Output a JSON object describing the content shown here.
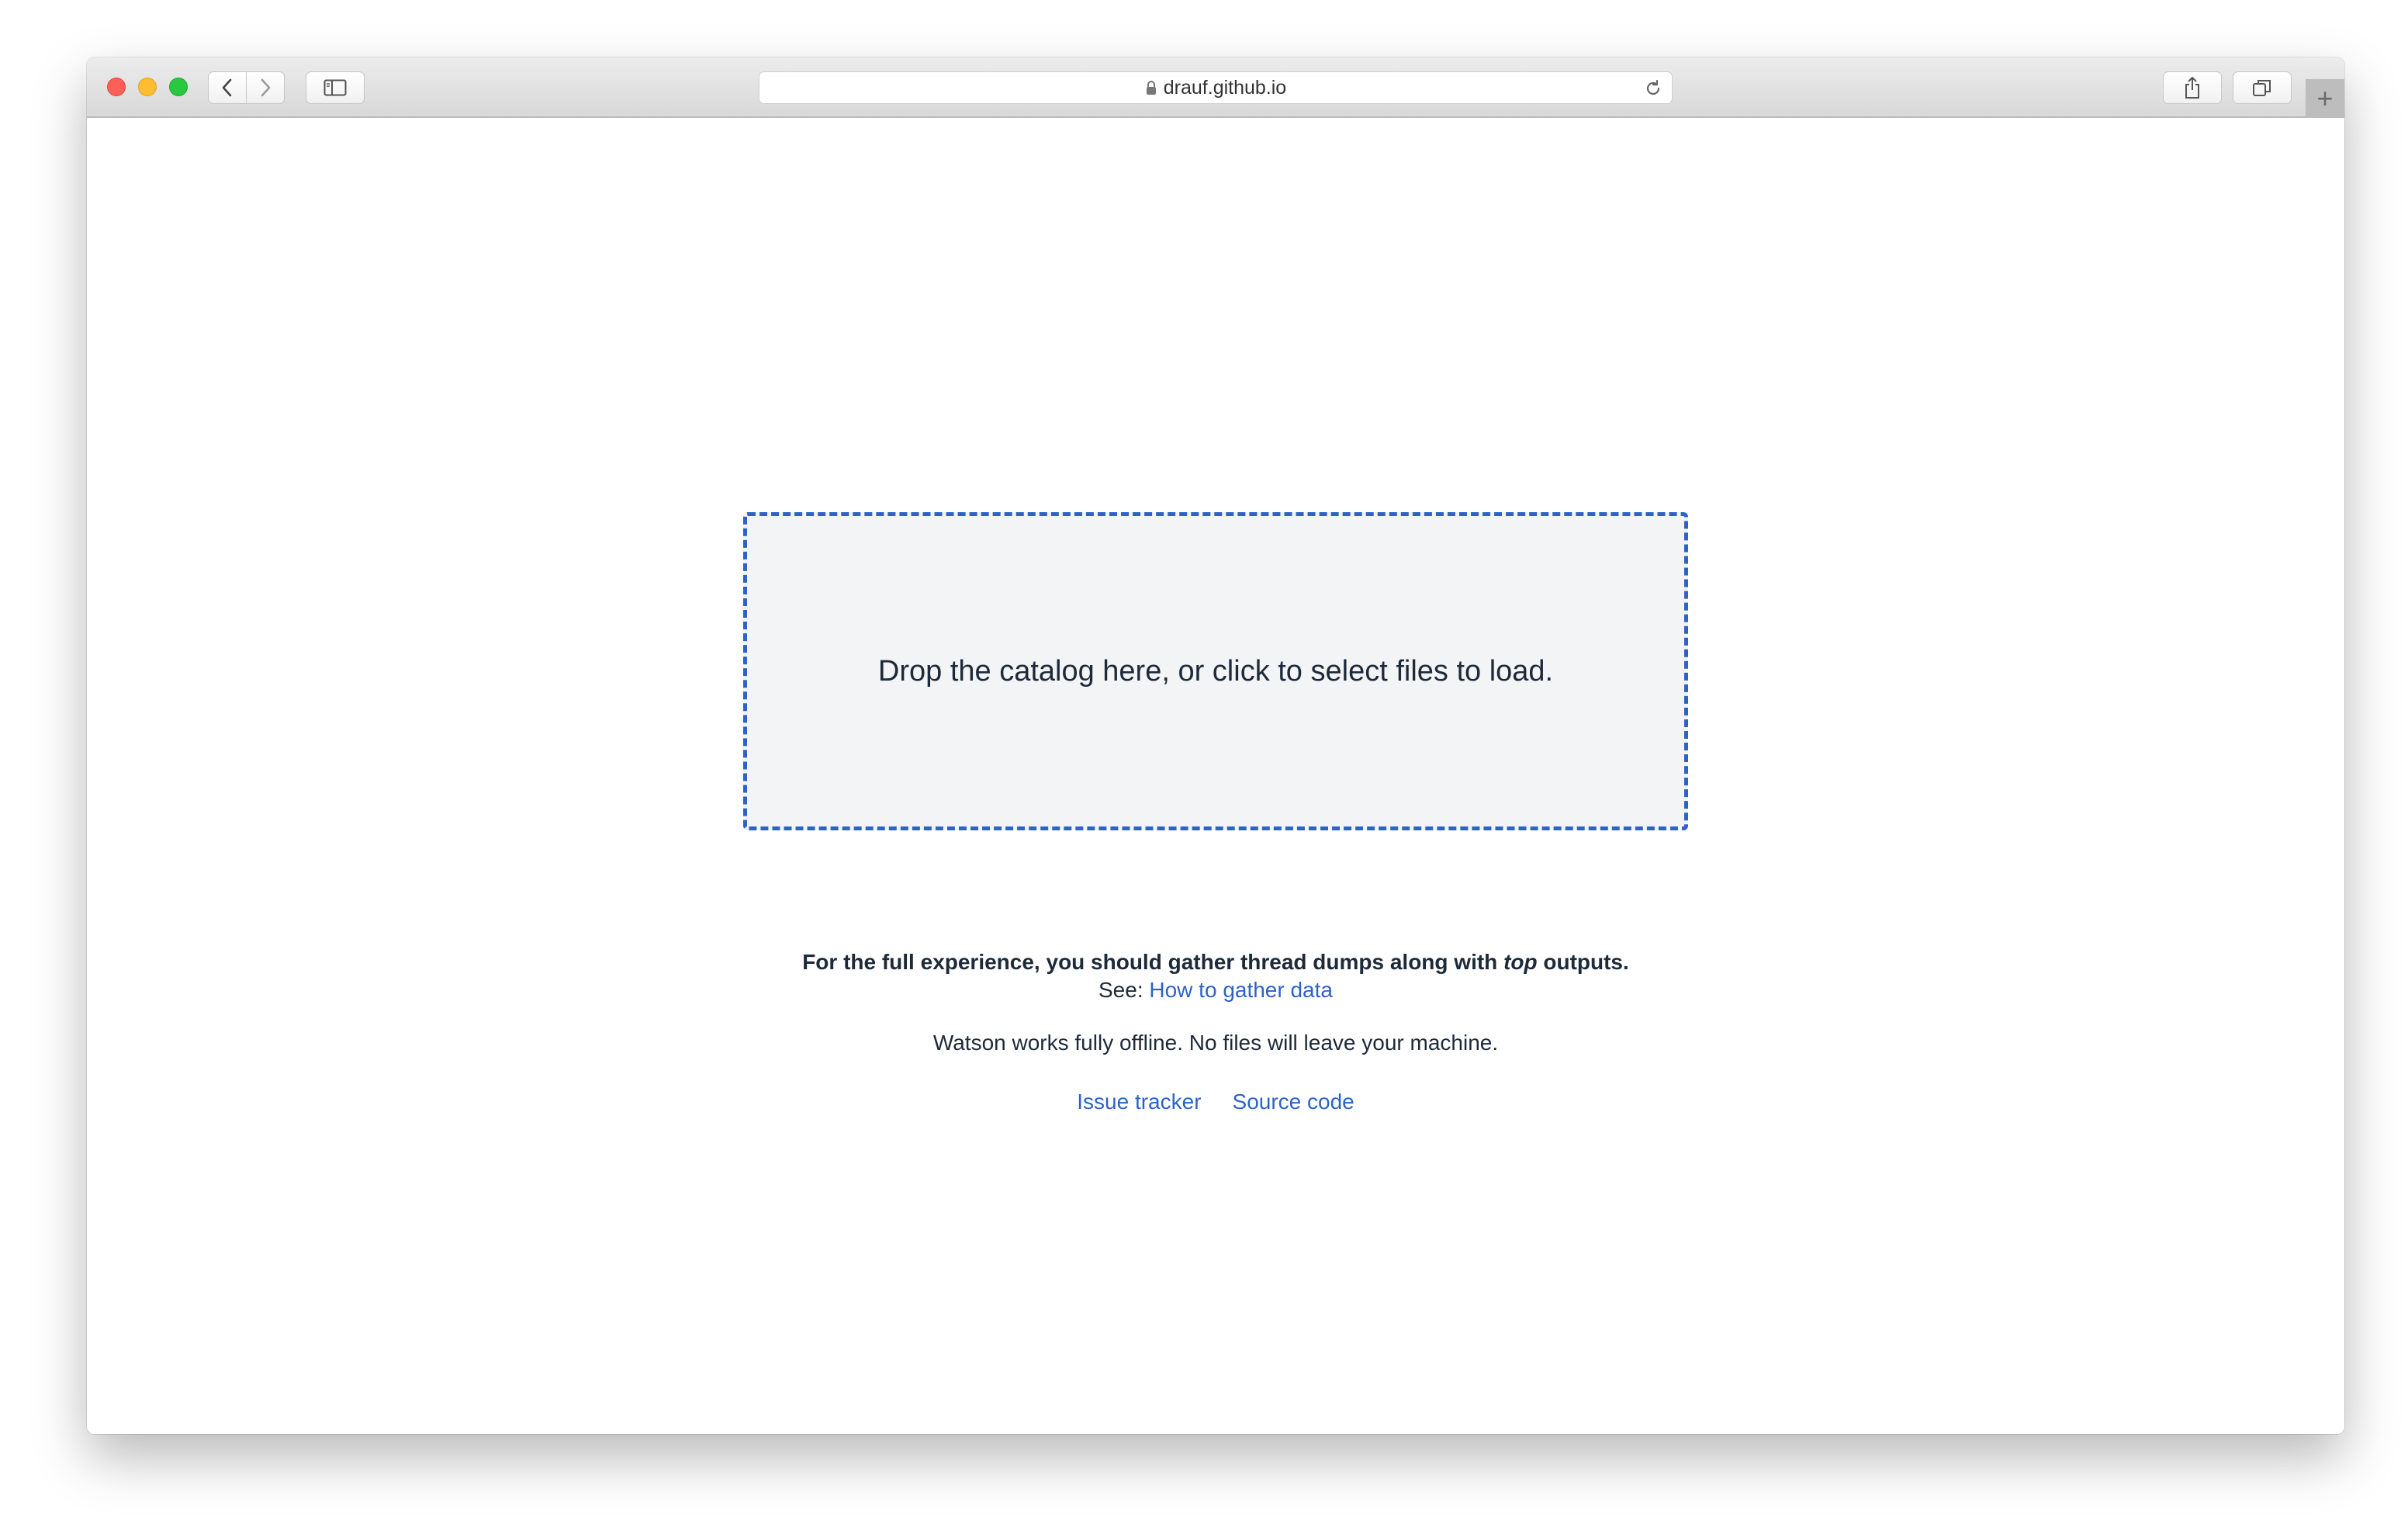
{
  "browser": {
    "address": "drauf.github.io",
    "icons": {
      "back": "chevron-left-icon",
      "forward": "chevron-right-icon",
      "sidebar": "sidebar-icon",
      "lock": "lock-icon",
      "reload": "reload-icon",
      "share": "share-icon",
      "tabs": "tabs-icon",
      "new_tab": "plus-icon"
    },
    "new_tab_label": "+"
  },
  "page": {
    "dropzone_label": "Drop the catalog here, or click to select files to load.",
    "note_prefix": "For the full experience, you should gather thread dumps along with ",
    "note_emphasis": "top",
    "note_suffix": " outputs.",
    "see_prefix": "See: ",
    "gather_link": "How to gather data",
    "offline_text": "Watson works fully offline. No files will leave your machine.",
    "links": {
      "issue_tracker": "Issue tracker",
      "source_code": "Source code"
    }
  },
  "colors": {
    "accent": "#2c63c5",
    "dropzone_bg": "#f3f4f6",
    "text": "#1d2a3a"
  }
}
